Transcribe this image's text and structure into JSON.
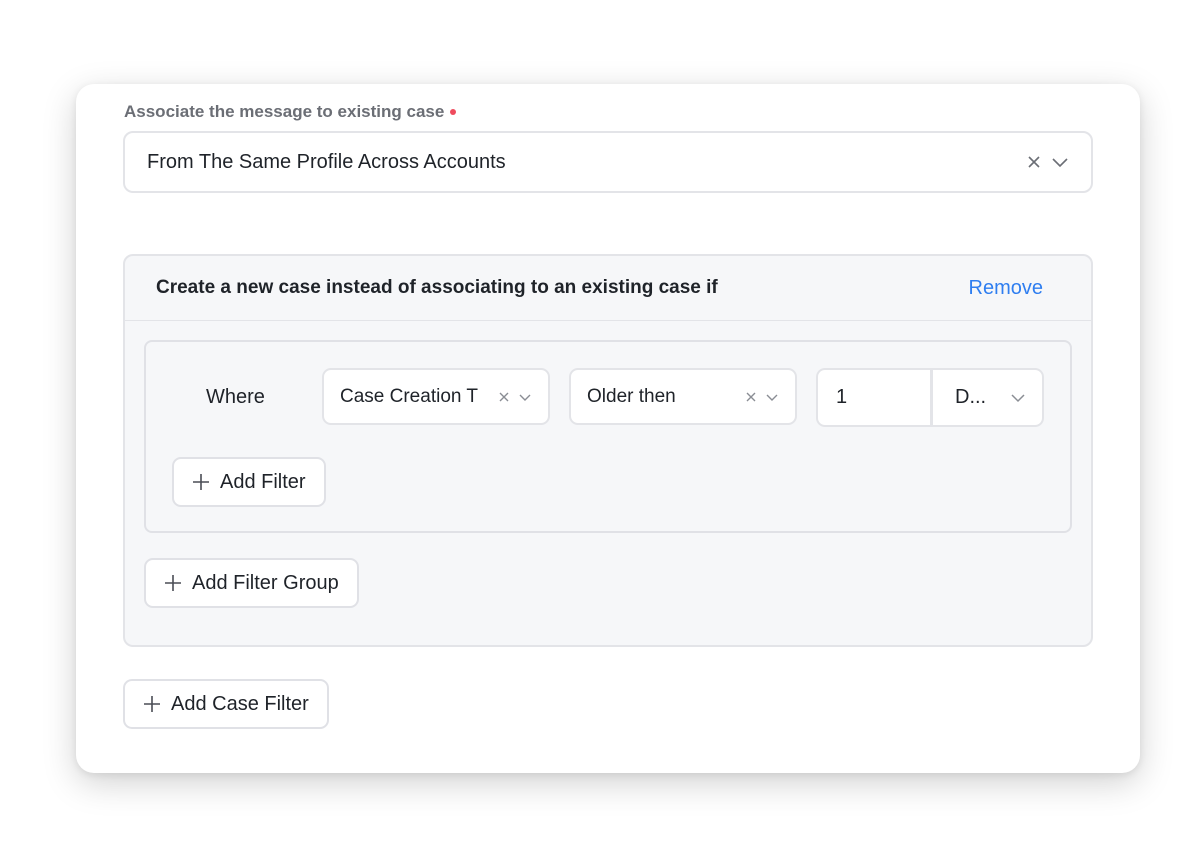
{
  "association": {
    "label": "Associate the message to existing case",
    "required_color": "#ef4b5d",
    "selected_value": "From The Same Profile Across Accounts"
  },
  "condition_panel": {
    "title": "Create a new case instead of associating to an existing case if",
    "remove_label": "Remove",
    "filter_group": {
      "where_label": "Where",
      "field_select": {
        "value": "Case Creation T"
      },
      "operator_select": {
        "value": "Older then"
      },
      "amount_input": {
        "value": "1"
      },
      "unit_select": {
        "value": "D..."
      },
      "add_filter_label": "Add Filter"
    },
    "add_filter_group_label": "Add Filter Group"
  },
  "add_case_filter_label": "Add Case Filter",
  "colors": {
    "link": "#2f7ef0",
    "panel_bg": "#f6f7f9",
    "border": "#e3e4e8"
  },
  "icons": {
    "clear": "close-icon",
    "dropdown": "chevron-down-icon",
    "add": "plus-icon"
  }
}
